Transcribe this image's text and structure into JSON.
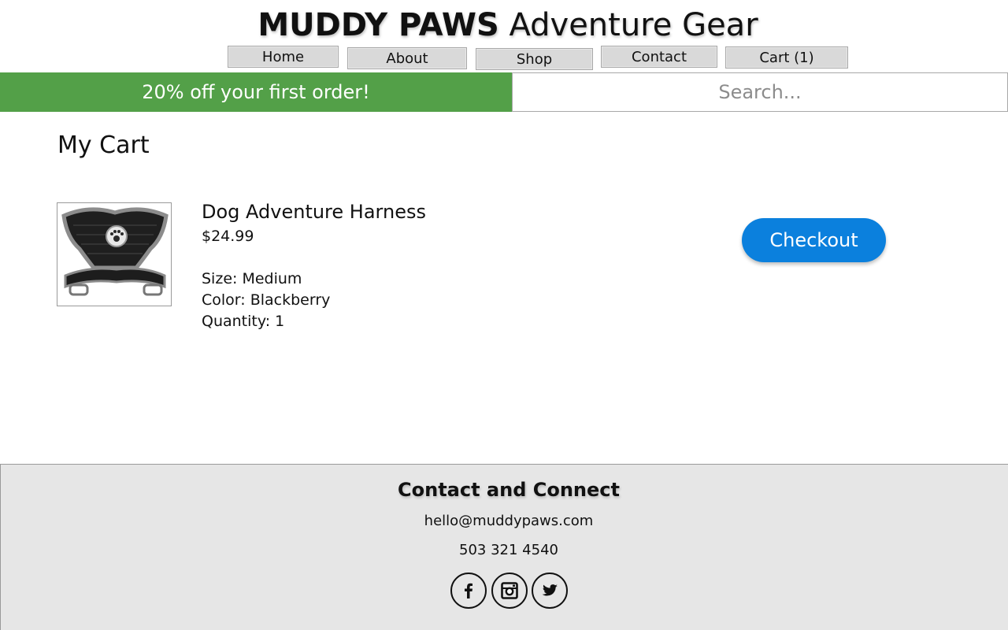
{
  "header": {
    "brand_bold": "MUDDY PAWS",
    "brand_light": "Adventure Gear",
    "nav": {
      "home": "Home",
      "about": "About",
      "shop": "Shop",
      "contact": "Contact",
      "cart": "Cart (1)"
    }
  },
  "promo": {
    "text": "20% off your first order!",
    "color": "#53a048"
  },
  "search": {
    "placeholder": "Search...",
    "value": ""
  },
  "cart": {
    "title": "My Cart",
    "item": {
      "image_icon": "dog-harness-product-image",
      "name": "Dog Adventure Harness",
      "price": "$24.99",
      "size": "Size: Medium",
      "color": "Color: Blackberry",
      "quantity": "Quantity: 1"
    },
    "checkout_label": "Checkout",
    "checkout_color": "#0b80dd"
  },
  "footer": {
    "title": "Contact and Connect",
    "email": "hello@muddypaws.com",
    "phone": "503 321 4540",
    "social_icons": [
      "facebook-icon",
      "instagram-icon",
      "twitter-icon"
    ]
  }
}
